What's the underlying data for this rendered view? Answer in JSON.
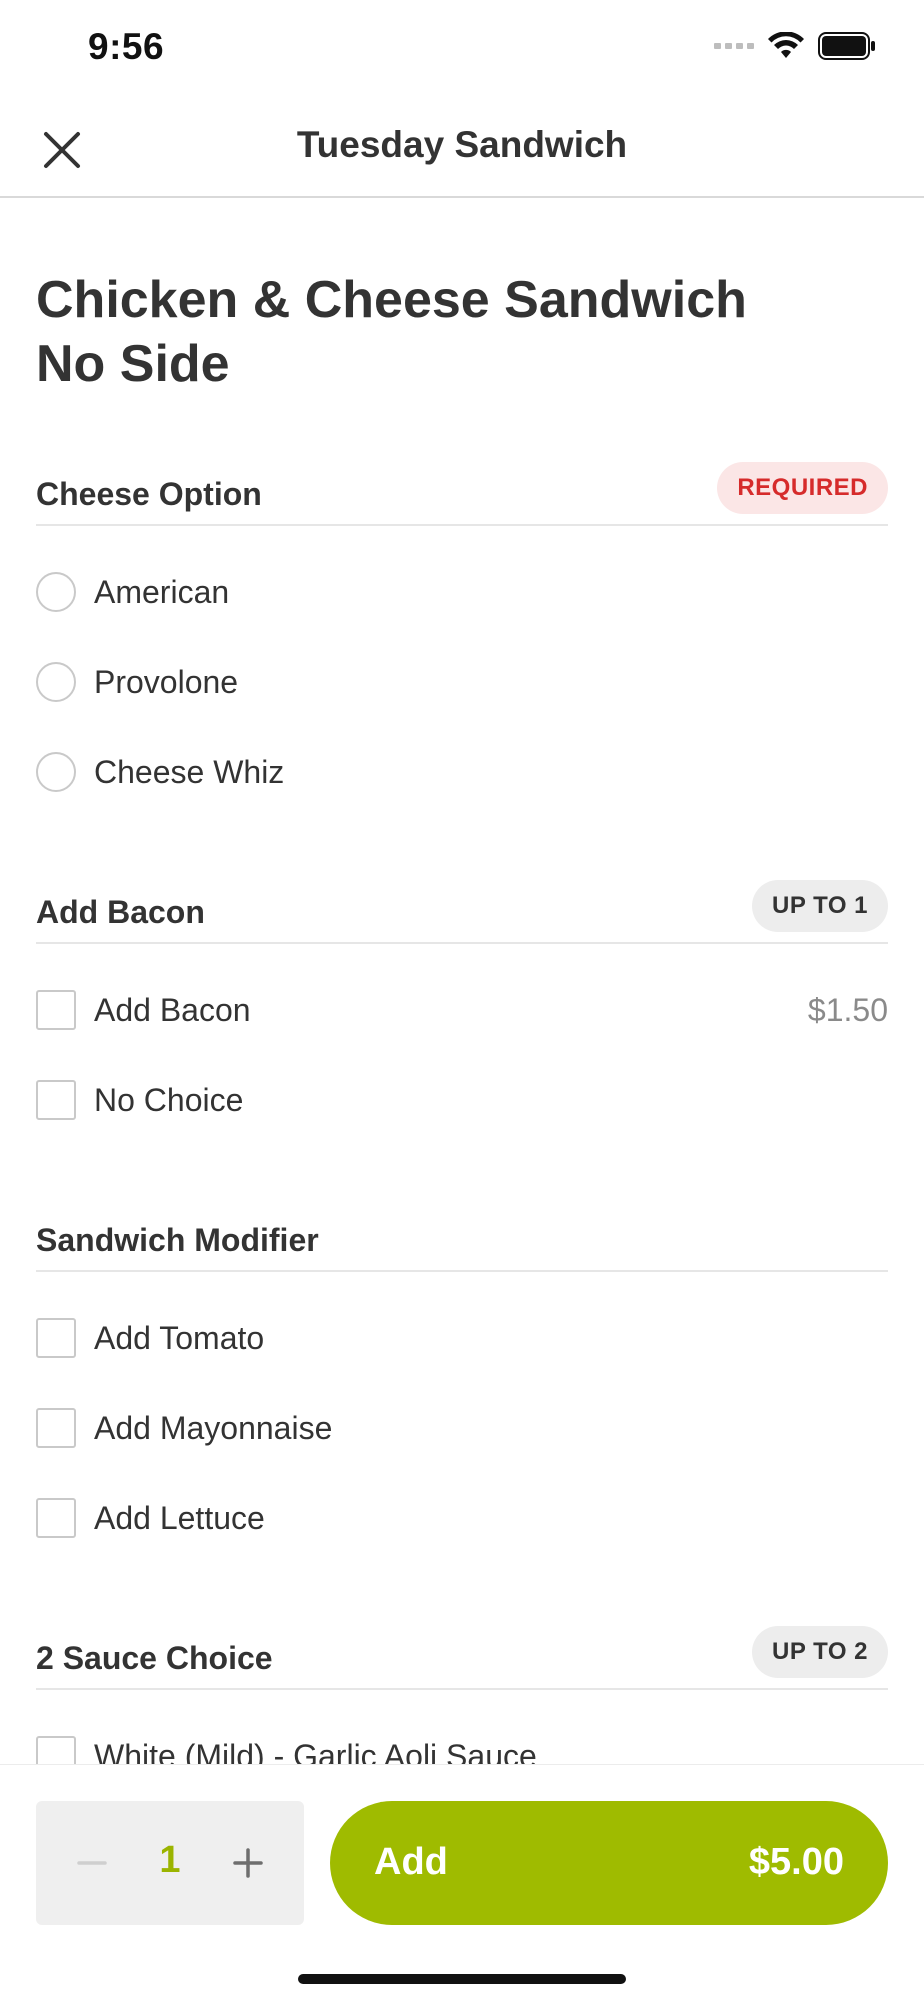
{
  "status_bar": {
    "time": "9:56"
  },
  "nav": {
    "title": "Tuesday Sandwich",
    "close_icon": "close-icon"
  },
  "item": {
    "title_line1": "Chicken & Cheese Sandwich",
    "title_line2": "No Side"
  },
  "sections": [
    {
      "title": "Cheese Option",
      "badge": "REQUIRED",
      "options": [
        {
          "label": "American"
        },
        {
          "label": "Provolone"
        },
        {
          "label": "Cheese Whiz"
        }
      ]
    },
    {
      "title": "Add Bacon",
      "badge": "UP TO 1",
      "options": [
        {
          "label": "Add Bacon",
          "price": "$1.50"
        },
        {
          "label": "No Choice"
        }
      ]
    },
    {
      "title": "Sandwich Modifier",
      "options": [
        {
          "label": "Add Tomato"
        },
        {
          "label": "Add Mayonnaise"
        },
        {
          "label": "Add Lettuce"
        }
      ]
    },
    {
      "title": "2 Sauce Choice",
      "badge": "UP TO 2",
      "options": [
        {
          "label": "White (Mild) - Garlic Aoli Sauce"
        }
      ]
    }
  ],
  "footer": {
    "quantity": "1",
    "add_label": "Add",
    "add_price": "$5.00"
  },
  "colors": {
    "accent": "#9fbb00",
    "required_text": "#d62b2b",
    "required_bg": "#fbe6e6"
  }
}
